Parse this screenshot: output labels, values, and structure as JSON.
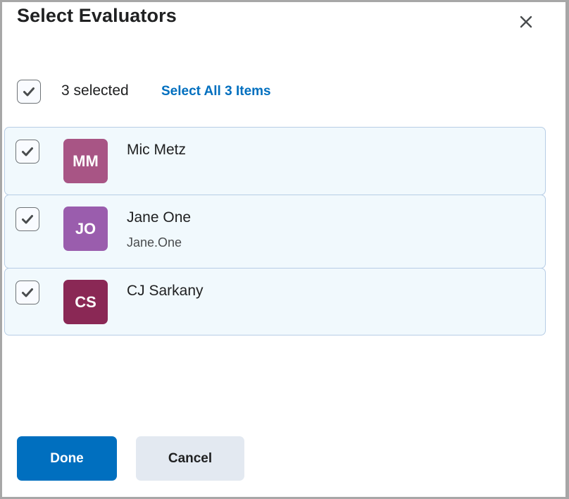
{
  "dialog": {
    "title": "Select Evaluators",
    "close_icon": "close-x-icon"
  },
  "selection": {
    "checked": true,
    "count_label": "3 selected",
    "select_all_label": "Select All 3 Items"
  },
  "evaluators": [
    {
      "initials": "MM",
      "name": "Mic Metz",
      "username": "",
      "avatar_color": "#a85585",
      "checked": true
    },
    {
      "initials": "JO",
      "name": "Jane One",
      "username": "Jane.One",
      "avatar_color": "#9a5dad",
      "checked": true
    },
    {
      "initials": "CS",
      "name": "CJ Sarkany",
      "username": "",
      "avatar_color": "#8a2855",
      "checked": true
    }
  ],
  "footer": {
    "done_label": "Done",
    "cancel_label": "Cancel"
  },
  "colors": {
    "primary": "#006fbf",
    "row_bg": "#f1f9fd",
    "row_border": "#b7cde5"
  }
}
